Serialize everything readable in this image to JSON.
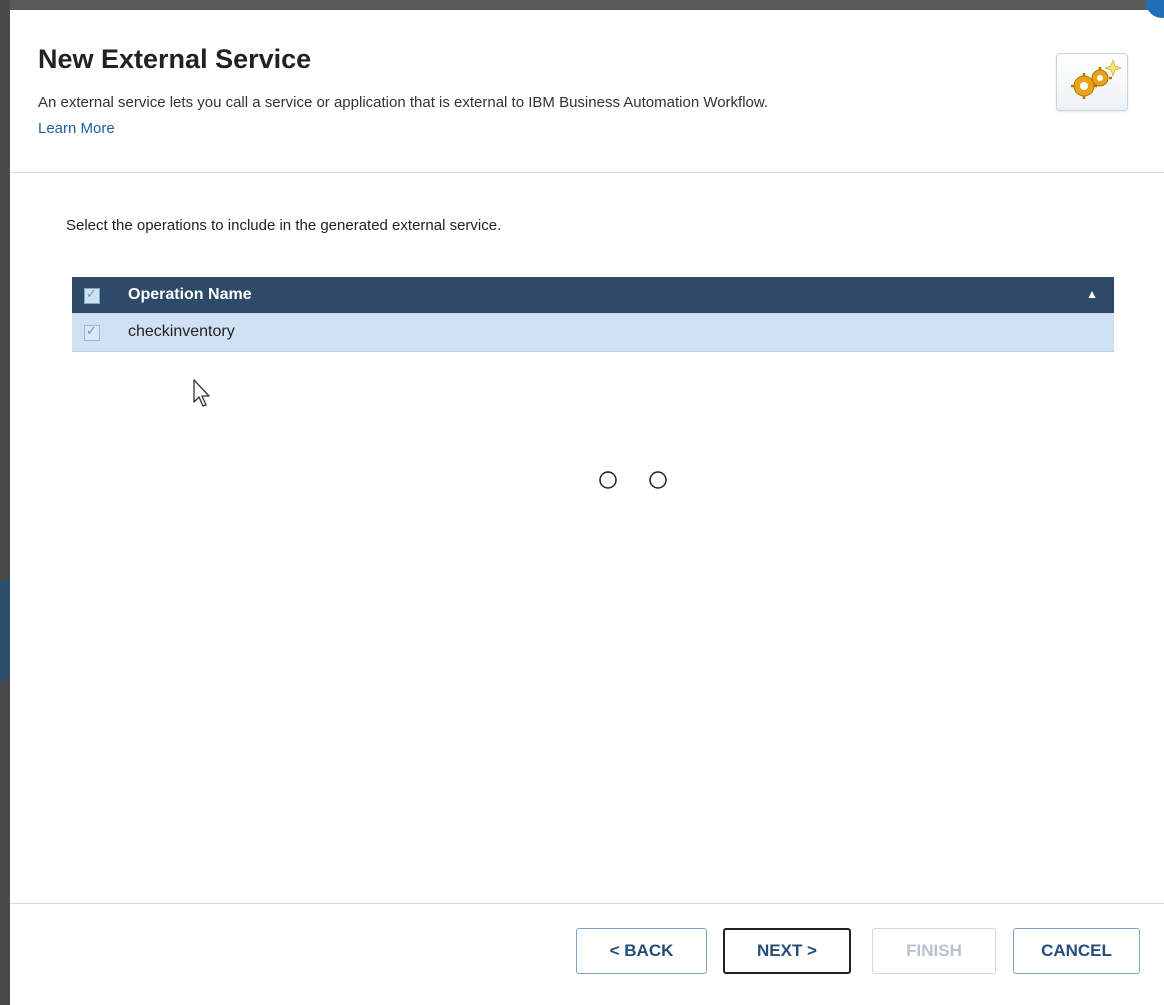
{
  "dialog": {
    "title": "New External Service",
    "description": "An external service lets you call a service or application that is external to IBM Business Automation Workflow.",
    "learn_more": "Learn More",
    "header_icon": "gears-icon"
  },
  "instruction": "Select the operations to include in the generated external service.",
  "operations_table": {
    "column_header": "Operation Name",
    "select_all_checked": true,
    "sort": "ascending",
    "rows": [
      {
        "name": "checkinventory",
        "checked": true
      }
    ]
  },
  "buttons": {
    "back": "< BACK",
    "next": "NEXT >",
    "finish": "FINISH",
    "cancel": "CANCEL"
  },
  "colors": {
    "header_bg": "#2d4a68",
    "row_selected_bg": "#cfe1f3",
    "button_text": "#244e7a",
    "link": "#1f5fa8"
  }
}
